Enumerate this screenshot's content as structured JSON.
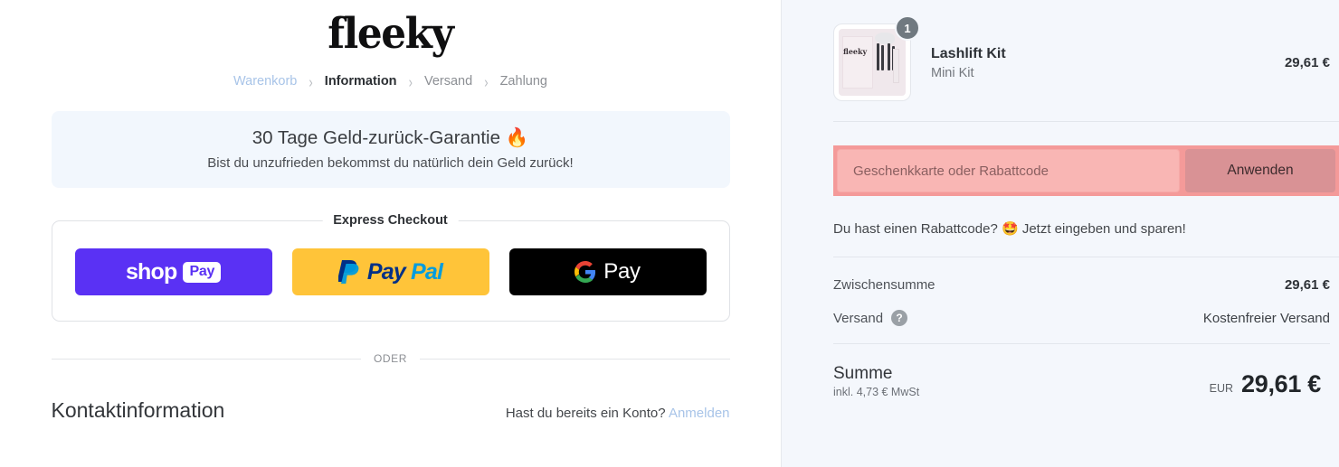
{
  "brand": {
    "logo_text": "fleeky"
  },
  "breadcrumb": {
    "items": [
      {
        "label": "Warenkorb",
        "state": "link"
      },
      {
        "label": "Information",
        "state": "current"
      },
      {
        "label": "Versand",
        "state": "inactive"
      },
      {
        "label": "Zahlung",
        "state": "inactive"
      }
    ],
    "separator": "›"
  },
  "guarantee": {
    "title": "30 Tage Geld-zurück-Garantie",
    "title_emoji": "🔥",
    "subtitle": "Bist du unzufrieden bekommst du natürlich dein Geld zurück!",
    "background": "#f2f7fd"
  },
  "express": {
    "label": "Express Checkout",
    "buttons": [
      {
        "name": "shop-pay",
        "word": "shop",
        "pill": "Pay",
        "bg": "#5a31f4"
      },
      {
        "name": "paypal",
        "word_dark": "Pay",
        "word_light": "Pal",
        "bg": "#ffc439"
      },
      {
        "name": "google-pay",
        "word": "Pay",
        "bg": "#000000"
      }
    ]
  },
  "divider": {
    "text": "ODER"
  },
  "contact": {
    "title": "Kontaktinformation",
    "account_question": "Hast du bereits ein Konto?",
    "login_link": "Anmelden"
  },
  "summary": {
    "line_item": {
      "title": "Lashlift Kit",
      "variant": "Mini Kit",
      "quantity": "1",
      "price": "29,61 €"
    },
    "discount": {
      "placeholder": "Geschenkkarte oder Rabattcode",
      "value": "",
      "apply_label": "Anwenden",
      "hint_before": "Du hast einen Rabattcode?",
      "hint_emoji": "🤩",
      "hint_after": "Jetzt eingeben und sparen!",
      "field_bg": "#f9b6b4",
      "bar_bg": "#f49a99",
      "button_bg": "#d99295"
    },
    "totals": [
      {
        "label": "Zwischensumme",
        "value": "29,61 €",
        "has_help": false,
        "bold": true
      },
      {
        "label": "Versand",
        "value": "Kostenfreier Versand",
        "has_help": true,
        "bold": false
      }
    ],
    "grand_total": {
      "label": "Summe",
      "tax_note": "inkl. 4,73 € MwSt",
      "currency": "EUR",
      "value": "29,61 €"
    },
    "help_icon_glyph": "?",
    "background": "#f4f7fc"
  }
}
